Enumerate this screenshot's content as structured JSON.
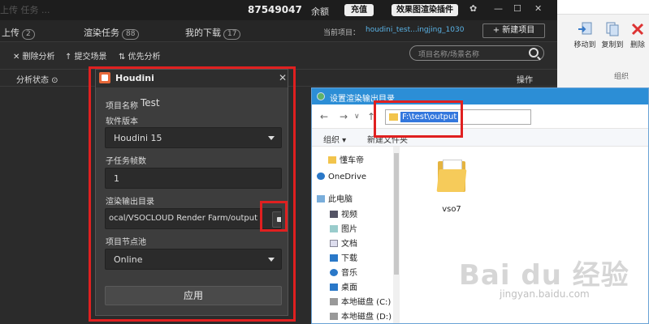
{
  "topbar": {
    "ghost": "上传   任务   ...",
    "account_id": "87549047",
    "balance": "余额",
    "recharge": "充值",
    "plugin": "效果图渲染插件",
    "icons": [
      "gear-icon",
      "minimize-icon",
      "maximize-icon",
      "close-icon"
    ]
  },
  "tabs": {
    "items": [
      {
        "label": "上传",
        "count": "2"
      },
      {
        "label": "渲染任务",
        "count": "88"
      },
      {
        "label": "我的下载",
        "count": "17"
      }
    ],
    "project_label": "当前项目：",
    "project_value": "houdini_test...ingjing_1030",
    "new_project": "+ 新建项目"
  },
  "toolbar": {
    "delete_analysis": "✕ 删除分析",
    "submit_scene": "↑ 提交场景",
    "priority_analysis": "⇅ 优先分析",
    "search_placeholder": "项目名称/场景名称"
  },
  "header": {
    "status": "分析状态",
    "operation": "操作"
  },
  "ribbon": {
    "move_to": "移动到",
    "copy_to": "复制到",
    "delete": "删除",
    "group": "组织"
  },
  "houdini_dialog": {
    "title": "Houdini",
    "project_name_label": "项目名称",
    "project_name_value": "Test",
    "software_version_label": "软件版本",
    "software_version_value": "Houdini 15",
    "subtask_frames_label": "子任务帧数",
    "subtask_frames_value": "1",
    "output_dir_label": "渲染输出目录",
    "output_dir_value": "ocal/VSOCLOUD Render Farm/output",
    "node_pool_label": "项目节点池",
    "node_pool_value": "Online",
    "apply_label": "应用"
  },
  "explorer": {
    "title": "设置渲染输出目录",
    "address": "F:\\test\\output",
    "organize": "组织 ▾",
    "new_folder": "新建文件夹",
    "tree": [
      {
        "label": "懂车帝",
        "icon": "folder-icon"
      },
      {
        "label": "OneDrive",
        "icon": "cloud-icon"
      },
      {
        "label": "此电脑",
        "icon": "computer-icon"
      },
      {
        "label": "视频",
        "icon": "video-icon"
      },
      {
        "label": "图片",
        "icon": "picture-icon"
      },
      {
        "label": "文档",
        "icon": "document-icon"
      },
      {
        "label": "下载",
        "icon": "download-icon"
      },
      {
        "label": "音乐",
        "icon": "music-icon"
      },
      {
        "label": "桌面",
        "icon": "desktop-icon"
      },
      {
        "label": "本地磁盘 (C:)",
        "icon": "drive-icon"
      },
      {
        "label": "本地磁盘 (D:)",
        "icon": "drive-icon"
      }
    ],
    "folder_name": "vso7"
  },
  "watermark": {
    "main": "Bai du 经验",
    "sub": "jingyan.baidu.com"
  },
  "colors": {
    "highlight": "#e02020",
    "accent_blue": "#2c8ed6",
    "link": "#5ab3e6"
  }
}
